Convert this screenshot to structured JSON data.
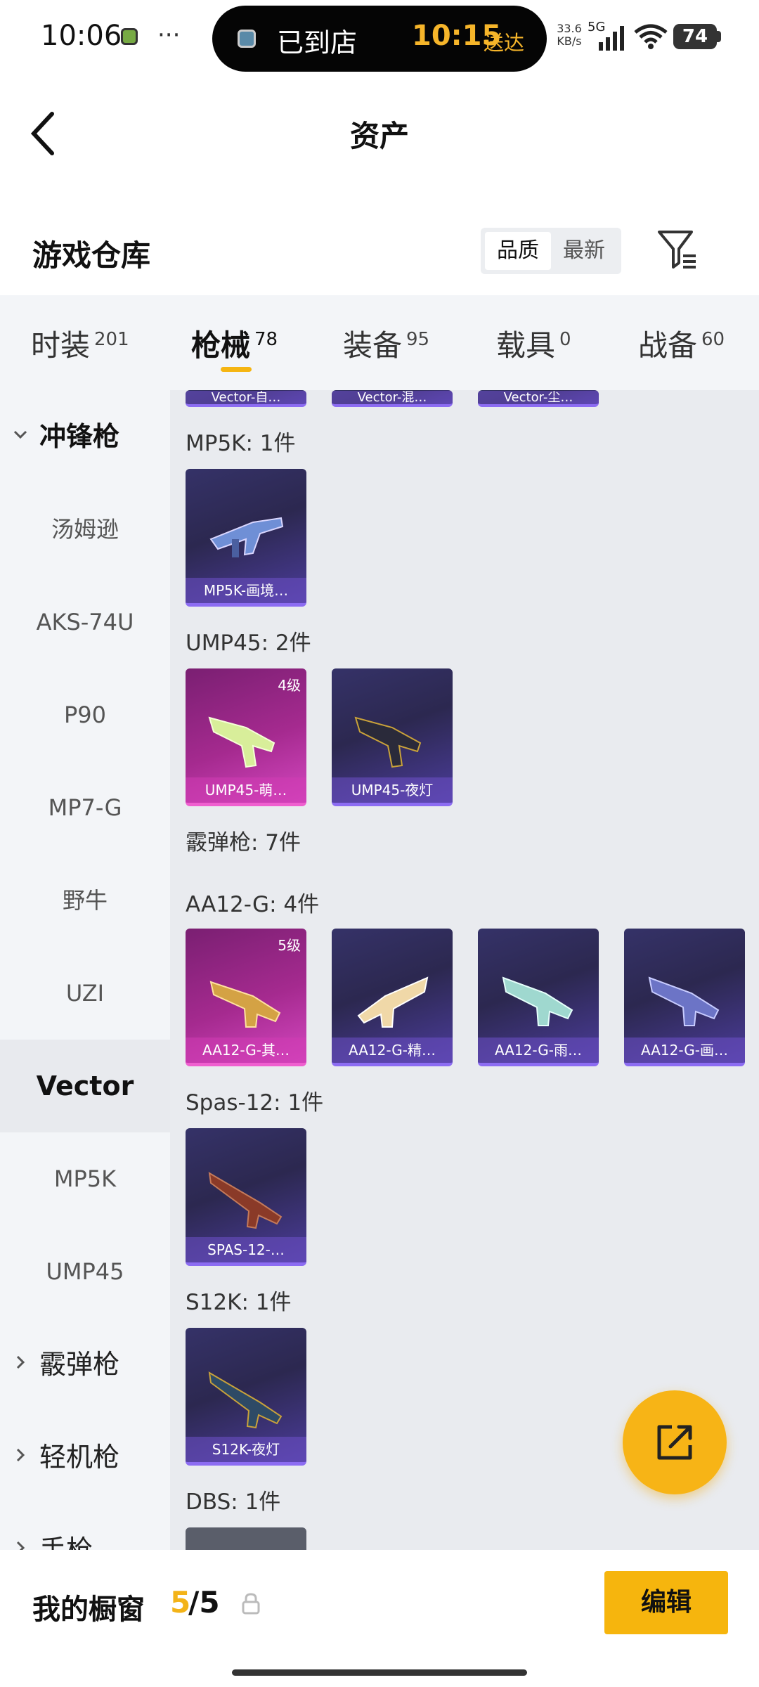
{
  "status_bar": {
    "time": "10:06",
    "dots": "···",
    "pill_text": "已到店",
    "pill_time": "10:15",
    "pill_action": "送达",
    "net_speed_value": "33.6",
    "net_speed_unit": "KB/s",
    "network": "5G",
    "wifi_level": "6",
    "battery": "74"
  },
  "header": {
    "title": "资产"
  },
  "section": {
    "title": "游戏仓库",
    "sort_options": [
      "品质",
      "最新"
    ],
    "sort_selected": "品质"
  },
  "tabs": [
    {
      "label": "时装",
      "count": "201"
    },
    {
      "label": "枪械",
      "count": "78"
    },
    {
      "label": "装备",
      "count": "95"
    },
    {
      "label": "载具",
      "count": "0"
    },
    {
      "label": "战备",
      "count": "60"
    }
  ],
  "active_tab": "枪械",
  "sidebar": {
    "groups": [
      {
        "label": "冲锋枪",
        "expanded": true
      },
      {
        "label": "霰弹枪",
        "expanded": false
      },
      {
        "label": "轻机枪",
        "expanded": false
      },
      {
        "label": "手枪",
        "expanded": false
      }
    ],
    "items": [
      "汤姆逊",
      "AKS-74U",
      "P90",
      "MP7-G",
      "野牛",
      "UZI",
      "Vector",
      "MP5K",
      "UMP45"
    ],
    "selected": "Vector"
  },
  "content": {
    "partial_cards": [
      "Vector-自…",
      "Vector-混…",
      "Vector-尘…"
    ],
    "categories": [
      {
        "label": "MP5K: 1件",
        "cards": [
          {
            "name": "MP5K-画境…",
            "level": "",
            "rarity": "purple"
          }
        ]
      },
      {
        "label": "UMP45: 2件",
        "cards": [
          {
            "name": "UMP45-萌…",
            "level": "4级",
            "rarity": "pink"
          },
          {
            "name": "UMP45-夜灯",
            "level": "",
            "rarity": "purple"
          }
        ]
      },
      {
        "label": "霰弹枪: 7件",
        "cards": []
      },
      {
        "label": "AA12-G: 4件",
        "cards": [
          {
            "name": "AA12-G-其…",
            "level": "5级",
            "rarity": "pink"
          },
          {
            "name": "AA12-G-精…",
            "level": "",
            "rarity": "purple"
          },
          {
            "name": "AA12-G-雨…",
            "level": "",
            "rarity": "purple"
          },
          {
            "name": "AA12-G-画…",
            "level": "",
            "rarity": "purple"
          }
        ]
      },
      {
        "label": "Spas-12: 1件",
        "cards": [
          {
            "name": "SPAS-12-…",
            "level": "",
            "rarity": "purple"
          }
        ]
      },
      {
        "label": "S12K: 1件",
        "cards": [
          {
            "name": "S12K-夜灯",
            "level": "",
            "rarity": "purple"
          }
        ]
      },
      {
        "label": "DBS: 1件",
        "cards": []
      }
    ]
  },
  "bottom": {
    "window_label": "我的橱窗",
    "window_count": "5",
    "window_total": "/5",
    "edit_label": "编辑"
  },
  "colors": {
    "accent": "#f6b50d",
    "tab_bg": "#f3f5f8",
    "content_bg": "#e9ebef",
    "purple_card": "#2c2850",
    "pink_card": "#a52a8f"
  }
}
